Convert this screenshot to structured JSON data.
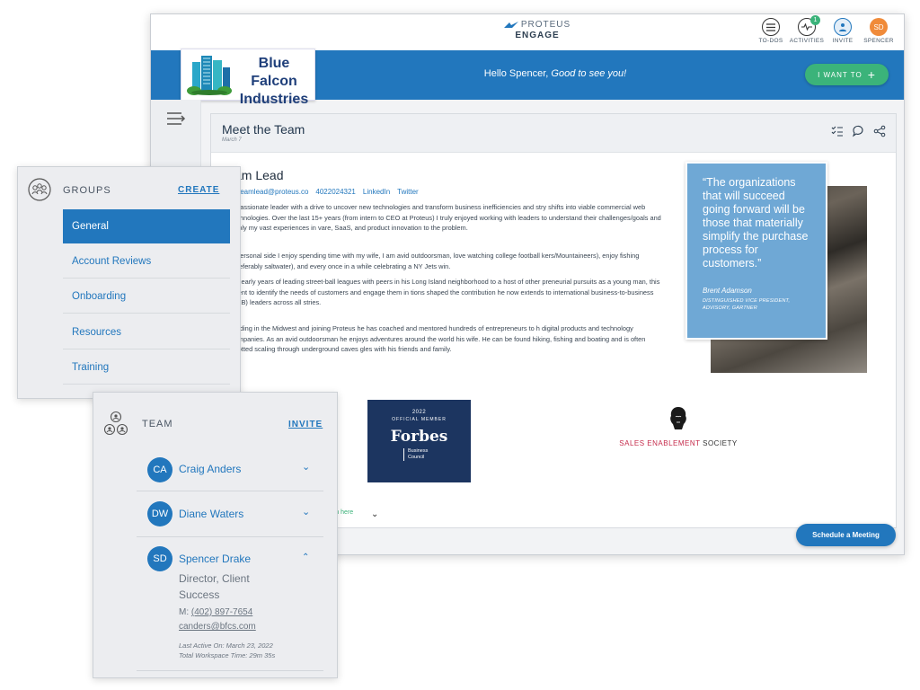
{
  "topbar": {
    "brand_line1": "PROTEUS",
    "brand_line2": "ENGAGE",
    "icons": [
      {
        "label": "TO-DOS",
        "icon": "todo-list-icon"
      },
      {
        "label": "ACTIVITIES",
        "icon": "activity-pulse-icon",
        "badge": "1"
      },
      {
        "label": "INVITE",
        "icon": "invite-people-icon"
      },
      {
        "label": "SPENCER",
        "icon": "user-avatar",
        "initials": "SD"
      }
    ]
  },
  "banner": {
    "logo_text_line1": "Blue Falcon",
    "logo_text_line2": "Industries",
    "greeting": "Hello Spencer,",
    "greeting_emphasis": "Good to see you!",
    "cta_label": "I WANT TO",
    "accent_color": "#2277bd",
    "cta_color": "#3bb37a"
  },
  "content": {
    "title": "Meet the Team",
    "date": "March 7",
    "lead_name": "am Lead",
    "contact": {
      "email": "teamlead@proteus.co",
      "phone": "4022024321",
      "linkedin": "LinkedIn",
      "twitter": "Twitter"
    },
    "paragraphs": [
      "a passionate leader with a drive to uncover new technologies and transform business inefficiencies and stry shifts into viable commercial web technologies. Over the last 15+ years (from intern to CEO at Proteus) I truly enjoyed working with leaders to understand their challenges/goals and apply my vast experiences in vare, SaaS, and product innovation to the problem.",
      "e personal side I enjoy spending time with my wife, I am avid outdoorsman, love watching college football kers/Mountaineers), enjoy fishing (preferably saltwater), and every once in a while celebrating a NY Jets win.",
      "his early years of leading street-ball leagues with peers in his Long Island neighborhood to a host of other preneurial pursuits as a young man, this talent to identify the needs of customers and engage them in tions shaped the contribution he now extends to international business-to-business (B2B) leaders across all stries.",
      "landing in the Midwest and joining Proteus he has coached and mentored hundreds of entrepreneurs to h digital products and technology companies. As an avid outdoorsman he enjoys adventures around the world his wife. He can be found hiking, fishing and boating and is often spotted scaling through underground caves gles with his friends and family."
    ],
    "quote": {
      "text": "“The organizations that will succeed going forward will be those that materially simplify the purchase process for customers.”",
      "author": "Brent Adamson",
      "role": "DISTINGUISHED VICE PRESIDENT, ADVISORY, GARTNER"
    },
    "forbes": {
      "year": "2022",
      "member": "OFFICIAL MEMBER",
      "brand": "Forbes",
      "council": "Business Council"
    },
    "ses": {
      "sales": "SALES ENABLEMENT",
      "society": "SOCIETY"
    },
    "learn_more": "rn here",
    "schedule_label": "Schedule a Meeting"
  },
  "groups": {
    "label": "GROUPS",
    "create_label": "CREATE",
    "items": [
      {
        "label": "General",
        "active": true
      },
      {
        "label": "Account Reviews"
      },
      {
        "label": "Onboarding"
      },
      {
        "label": "Resources"
      },
      {
        "label": "Training"
      }
    ]
  },
  "team": {
    "label": "TEAM",
    "invite_label": "INVITE",
    "members": [
      {
        "initials": "CA",
        "name": "Craig Anders"
      },
      {
        "initials": "DW",
        "name": "Diane Waters"
      },
      {
        "initials": "SD",
        "name": "Spencer Drake",
        "title": "Director, Client Success",
        "phone_prefix": "M:",
        "phone": "(402) 897-7654",
        "email": "canders@bfcs.com",
        "last_active": "Last Active On: March 23, 2022",
        "workspace_time": "Total Workspace Time: 29m 35s"
      }
    ]
  }
}
